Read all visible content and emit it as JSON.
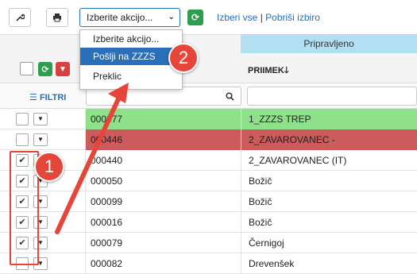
{
  "toolbar": {
    "wrench_icon": "wrench-icon",
    "print_icon": "print-icon",
    "action_select": "Izberite akcijo...",
    "refresh_icon": "refresh-icon",
    "select_all": "Izberi vse",
    "separator": "|",
    "clear_selection": "Pobriši izbiro"
  },
  "dropdown": {
    "items": [
      {
        "label": "Izberite akcijo...",
        "active": false
      },
      {
        "label": "Pošlji na ZZZS",
        "active": true
      },
      {
        "label": "Preklic",
        "active": false
      }
    ]
  },
  "grid": {
    "group_header": "Pripravljeno",
    "sort_column": "PRIIMEK",
    "sort_arrow": "🡓",
    "filter_label": "FILTRI",
    "rows": [
      {
        "code": "000077",
        "name": "1_ZZZS TREP",
        "checked": false,
        "status": "green"
      },
      {
        "code": "000446",
        "name": "2_ZAVAROVANEC -",
        "checked": false,
        "status": "red"
      },
      {
        "code": "000440",
        "name": "2_ZAVAROVANEC (IT)",
        "checked": true,
        "status": ""
      },
      {
        "code": "000050",
        "name": "Božič",
        "checked": true,
        "status": ""
      },
      {
        "code": "000099",
        "name": "Božič",
        "checked": true,
        "status": ""
      },
      {
        "code": "000016",
        "name": "Božič",
        "checked": true,
        "status": ""
      },
      {
        "code": "000079",
        "name": "Černigoj",
        "checked": true,
        "status": ""
      },
      {
        "code": "000082",
        "name": "Drevenšek",
        "checked": false,
        "status": ""
      }
    ]
  },
  "annotations": {
    "badge_1": "1",
    "badge_2": "2",
    "color": "#e6463a"
  }
}
